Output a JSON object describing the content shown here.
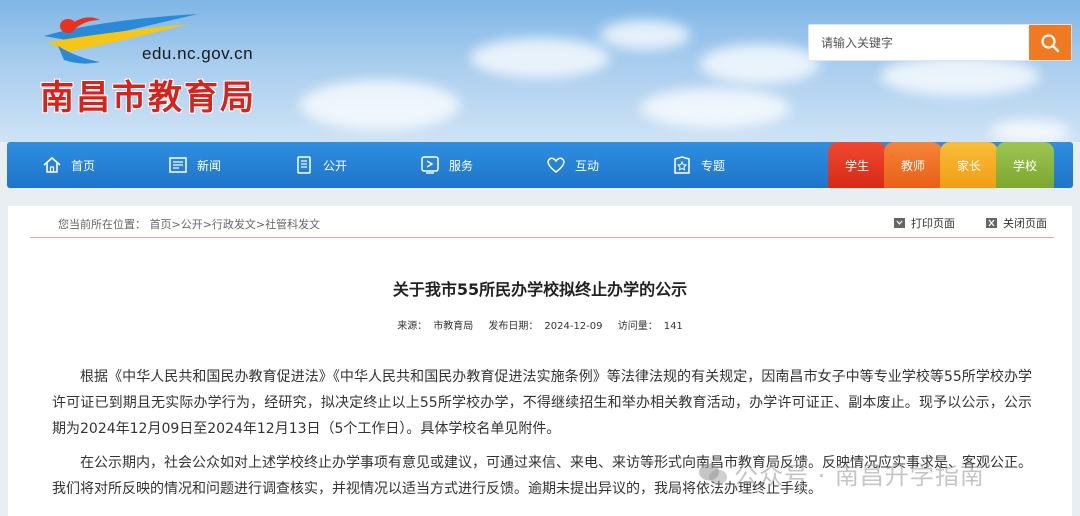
{
  "header": {
    "domain": "edu.nc.gov.cn",
    "site_name": "南昌市教育局"
  },
  "search": {
    "placeholder": "请输入关键字",
    "icon": "search-icon"
  },
  "nav": {
    "items": [
      {
        "label": "首页",
        "icon": "home-icon"
      },
      {
        "label": "新闻",
        "icon": "newspaper-icon"
      },
      {
        "label": "公开",
        "icon": "document-list-icon"
      },
      {
        "label": "服务",
        "icon": "service-icon"
      },
      {
        "label": "互动",
        "icon": "heart-hands-icon"
      },
      {
        "label": "专题",
        "icon": "topic-icon"
      }
    ],
    "tags": [
      {
        "label": "学生",
        "color": "#e8321e"
      },
      {
        "label": "教师",
        "color": "#f06a1f"
      },
      {
        "label": "家长",
        "color": "#f5a623"
      },
      {
        "label": "学校",
        "color": "#8cb63c"
      }
    ]
  },
  "breadcrumb": {
    "prefix": "您当前所在位置：",
    "path": "首页>公开>行政发文>社管科发文"
  },
  "tools": {
    "print": "打印页面",
    "close": "关闭页面"
  },
  "article": {
    "title": "关于我市55所民办学校拟终止办学的公示",
    "source_label": "来源：",
    "source": "市教育局",
    "date_label": "发布日期：",
    "date": "2024-12-09",
    "views_label": "访问量：",
    "views": "141",
    "paragraphs": [
      "根据《中华人民共和国民办教育促进法》《中华人民共和国民办教育促进法实施条例》等法律法规的有关规定，因南昌市女子中等专业学校等55所学校办学许可证已到期且无实际办学行为，经研究，拟决定终止以上55所学校办学，不得继续招生和举办相关教育活动，办学许可证正、副本废止。现予以公示，公示期为2024年12月09日至2024年12月13日（5个工作日）。具体学校名单见附件。",
      "在公示期内，社会公众如对上述学校终止办学事项有意见或建议，可通过来信、来电、来访等形式向南昌市教育局反馈。反映情况应实事求是、客观公正。我们将对所反映的情况和问题进行调查核实，并视情况以适当方式进行反馈。逾期未提出异议的，我局将依法办理终止手续。"
    ]
  },
  "watermark": {
    "text": "公众号 · 南昌升学指南"
  },
  "colors": {
    "nav_blue": "#1f74c9",
    "site_red": "#d6241c",
    "search_orange": "#f07a22"
  }
}
